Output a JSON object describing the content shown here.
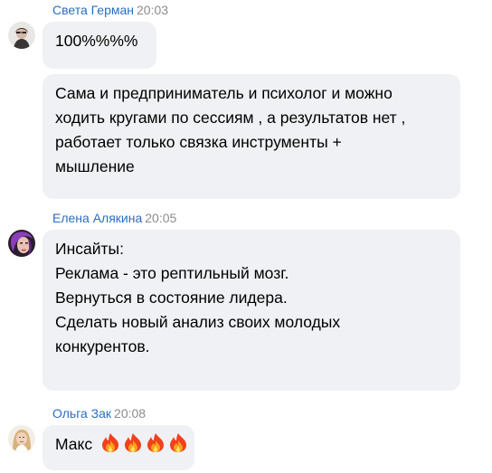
{
  "messages": [
    {
      "author": "Света Герман",
      "time": "20:03",
      "bubbles": [
        [
          "100%%%%"
        ],
        [
          "Сама и предприниматель и психолог и можно",
          "ходить кругами по сессиям , а результатов нет ,",
          "работает только связка инструменты +",
          "мышление"
        ]
      ]
    },
    {
      "author": "Елена Алякина",
      "time": "20:05",
      "bubbles": [
        [
          "Инсайты:",
          "Реклама - это рептильный мозг.",
          "Вернуться в состояние лидера.",
          "Сделать новый анализ своих молодых",
          "конкурентов."
        ]
      ]
    },
    {
      "author": "Ольга Зак",
      "time": "20:08",
      "bubbles": [
        [
          "Макс"
        ]
      ],
      "emoji": [
        "fire-emoji",
        "fire-emoji",
        "fire-emoji",
        "fire-emoji"
      ]
    }
  ]
}
